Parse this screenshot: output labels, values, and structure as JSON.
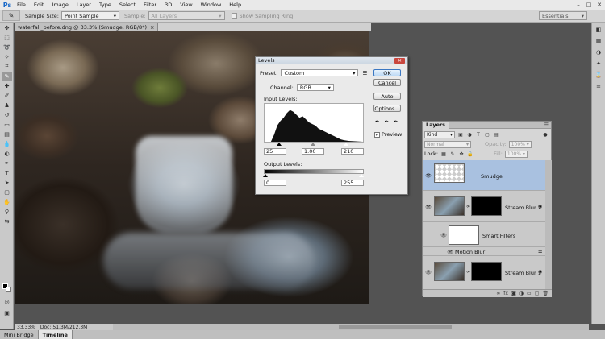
{
  "menu": {
    "logo": "Ps",
    "items": [
      "File",
      "Edit",
      "Image",
      "Layer",
      "Type",
      "Select",
      "Filter",
      "3D",
      "View",
      "Window",
      "Help"
    ],
    "window_controls": [
      "–",
      "□",
      "✕"
    ]
  },
  "options": {
    "sample_size_label": "Sample Size:",
    "sample_size_value": "Point Sample",
    "sample_label": "Sample:",
    "sample_value": "All Layers",
    "sampling_ring_label": "Show Sampling Ring",
    "workspace": "Essentials"
  },
  "document": {
    "tab_title": "waterfall_before.dng @ 33.3% (Smudge, RGB/8*)",
    "tab_close": "×",
    "zoom": "33.33%",
    "doc_info": "Doc: 51.3M/212.3M"
  },
  "bottom_tabs": [
    "Mini Bridge",
    "Timeline"
  ],
  "levels": {
    "title": "Levels",
    "preset_label": "Preset:",
    "preset_value": "Custom",
    "channel_label": "Channel:",
    "channel_value": "RGB",
    "input_label": "Input Levels:",
    "input_black": "25",
    "input_gamma": "1.00",
    "input_white": "210",
    "output_label": "Output Levels:",
    "output_black": "0",
    "output_white": "255",
    "buttons": {
      "ok": "OK",
      "cancel": "Cancel",
      "auto": "Auto",
      "options": "Options..."
    },
    "preview_label": "Preview",
    "preview_checked": true
  },
  "layers_panel": {
    "tab": "Layers",
    "kind_label": "Kind",
    "blend_mode": "Normal",
    "opacity_label": "Opacity:",
    "opacity_value": "100%",
    "lock_label": "Lock:",
    "fill_label": "Fill:",
    "fill_value": "100%",
    "layers": [
      {
        "name": "Smudge",
        "selected": true
      },
      {
        "name": "Stream Blur 2",
        "selected": false
      },
      {
        "name": "Smart Filters",
        "selected": false
      },
      {
        "name": "Motion Blur",
        "selected": false
      },
      {
        "name": "Stream Blur 1",
        "selected": false
      }
    ]
  }
}
